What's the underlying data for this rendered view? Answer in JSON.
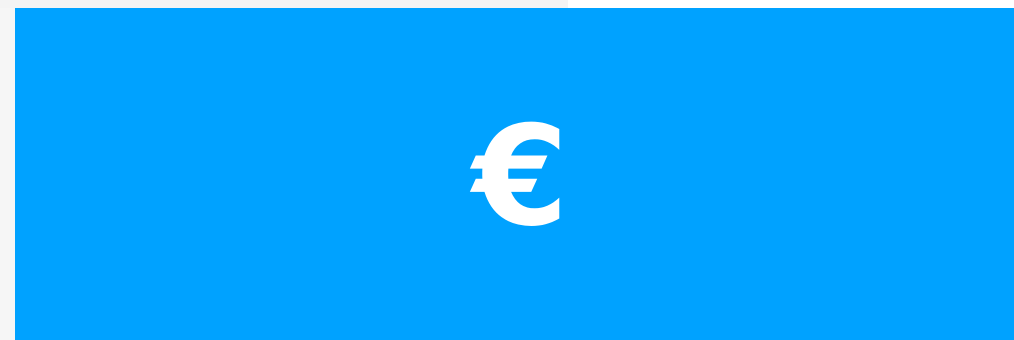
{
  "banner": {
    "icon_name": "euro-icon",
    "symbol": "€",
    "background_color": "#00a2ff",
    "symbol_color": "#ffffff"
  }
}
